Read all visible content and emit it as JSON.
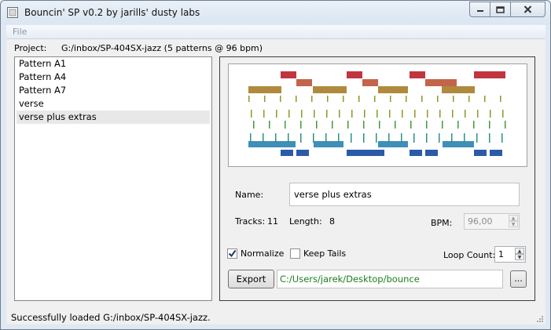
{
  "window": {
    "title": "Bouncin' SP v0.2 by jarills' dusty labs",
    "icon": "app-square-icon"
  },
  "menu": {
    "file": "File"
  },
  "project": {
    "label": "Project:",
    "path": "G:/inbox/SP-404SX-jazz (5 patterns @ 96 bpm)"
  },
  "patterns": [
    {
      "label": "Pattern A1"
    },
    {
      "label": "Pattern A4"
    },
    {
      "label": "Pattern A7"
    },
    {
      "label": "verse"
    },
    {
      "label": "verse plus extras",
      "selected": true
    }
  ],
  "details": {
    "name_label": "Name:",
    "name_value": "verse plus extras",
    "tracks_label": "Tracks:",
    "tracks_value": "11",
    "length_label": "Length:",
    "length_value": "8",
    "bpm_label": "BPM:",
    "bpm_value": "96,00"
  },
  "options": {
    "normalize_label": "Normalize",
    "normalize_checked": true,
    "keep_tails_label": "Keep Tails",
    "keep_tails_checked": false,
    "loop_count_label": "Loop Count:",
    "loop_count_value": "1"
  },
  "export": {
    "button_label": "Export",
    "path": "C:/Users/jarek/Desktop/bounce",
    "browse_label": "..."
  },
  "status": "Successfully loaded G:/inbox/SP-404SX-jazz.",
  "colors": {
    "red": "#c0353f",
    "orange": "#c3644b",
    "ochre": "#b08a3c",
    "olive": "#8a9a2a",
    "green": "#3f9a3c",
    "teal": "#2f8f8a",
    "sky": "#3f8fb8",
    "blue": "#2b5ba8",
    "path_green": "#1e7e1e"
  }
}
